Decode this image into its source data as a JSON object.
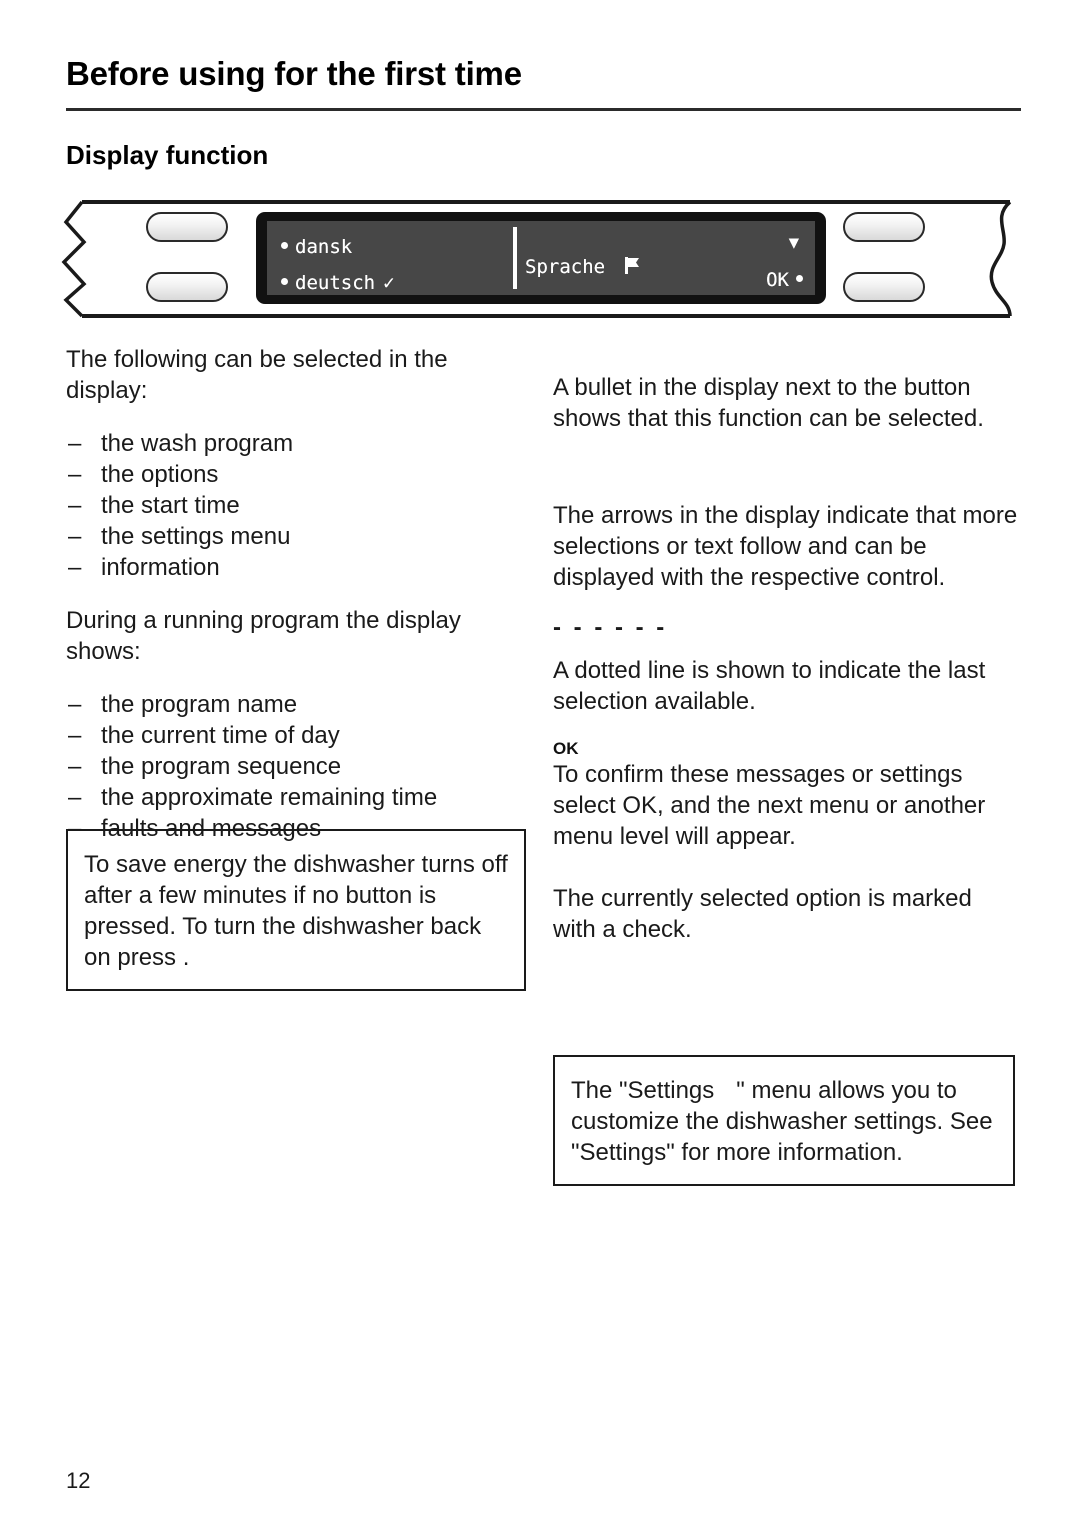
{
  "header": {
    "chapter_title": "Before using for the first time",
    "section_title": "Display function"
  },
  "illustration": {
    "name": "dishwasher-control-panel",
    "buttons": [
      "button-top-left",
      "button-bottom-left",
      "button-top-right",
      "button-bottom-right"
    ],
    "display": {
      "left_option_1": "dansk",
      "left_option_2": "deutsch",
      "left_option_2_check": "✓",
      "center_label": "Sprache",
      "center_icon": "flag-icon",
      "down_arrow": "▼",
      "ok_label": "OK",
      "screen_color": "#474747",
      "bezel_color": "#111111",
      "text_color": "#ffffff"
    }
  },
  "left_column": {
    "intro": "The following can be selected in the display:",
    "list_1": [
      "the wash program",
      "the options",
      "the start time",
      "the settings menu",
      "information"
    ],
    "running_intro": "During a running program the display shows:",
    "list_2": [
      "the program name",
      "the current time of day",
      "the program sequence",
      "the approximate remaining time",
      "faults and messages"
    ],
    "note_box": "To save energy the dishwasher turns off after a few minutes if no button is pressed. To turn the dishwasher back on press ."
  },
  "right_column": {
    "bullet_paragraph": "A bullet in the display next to the button shows that this function can be selected.",
    "arrows_paragraph": "The arrows in the display indicate that more selections or text follow and can be displayed with the respective control.",
    "dashed_marker": "- - - - - -",
    "dashed_paragraph": "A dotted line is shown to indicate the last selection available.",
    "ok_label": "OK",
    "ok_paragraph": "To confirm these messages or settings select OK, and the next menu or another menu level will appear.",
    "check_paragraph": "The currently selected option is marked with a check.",
    "settings_box_line1_pre": "The \"Settings",
    "settings_box_line1_post": "\" menu allows you to",
    "settings_box_line2": "customize the dishwasher settings.",
    "settings_box_line3": "See \"Settings\" for more information."
  },
  "footer": {
    "page_number": "12"
  }
}
